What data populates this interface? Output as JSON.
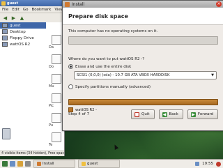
{
  "file_manager": {
    "title": "guest",
    "menu": [
      "File",
      "Edit",
      "Go",
      "Bookmark",
      "View"
    ],
    "sidebar_items": [
      "guest",
      "Desktop",
      "Floppy Drive",
      "wattOS R2"
    ],
    "main_items": [
      "Da",
      "Do",
      "Mu",
      "Pic",
      "Pu",
      "Te"
    ],
    "status": "4 visible items (34 hidden), Free space: 46..."
  },
  "installer": {
    "title": "Install",
    "heading": "Prepare disk space",
    "message": "This computer has no operating systems on it.",
    "question": "Where do you want to put wattOS R2 -?",
    "option_erase": "Erase and use the entire disk",
    "disk_selected": "SCSI1 (0,0,0) (sda) - 10.7 GB ATA VBOX HARDDISK",
    "option_manual": "Specify partitions manually (advanced)",
    "legend_label": "wattOS R2 -",
    "step": "Step 4 of 7",
    "buttons": {
      "quit": "Quit",
      "back": "Back",
      "forward": "Forward"
    }
  },
  "taskbar": {
    "tasks": [
      "Install",
      "guest"
    ],
    "clock": "19:55"
  },
  "colors": {
    "partition_new": "#b8752a",
    "titlebar_fm": "#3e66a8",
    "desktop": "#2c5a2c"
  }
}
